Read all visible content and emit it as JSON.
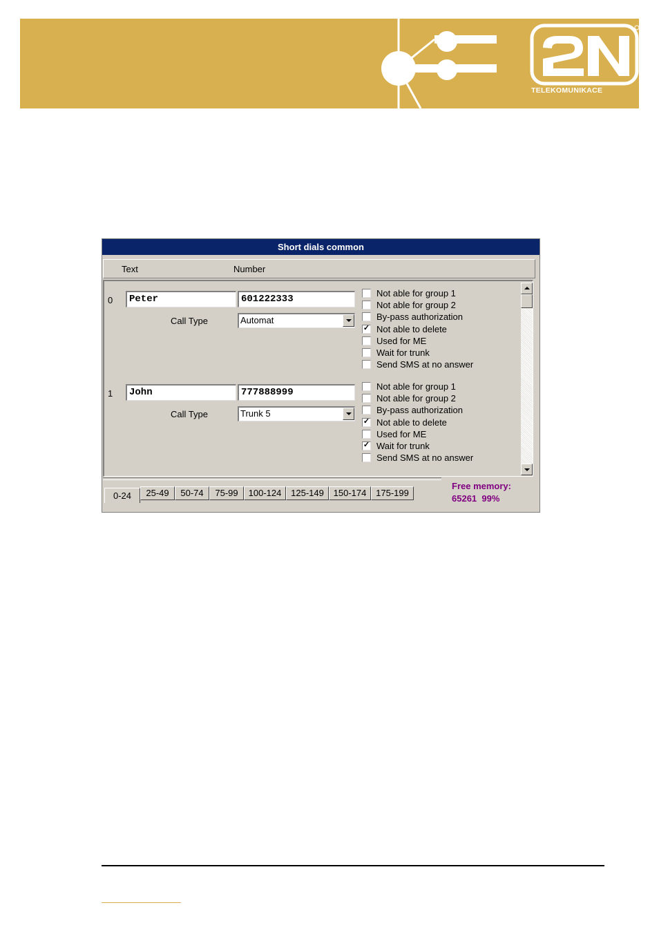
{
  "header": {
    "brand_color": "#d9b04f",
    "logo_text": "2N",
    "logo_tagline": "TELEKOMUNIKACE"
  },
  "window": {
    "title": "Short dials common",
    "columns": {
      "text": "Text",
      "number": "Number"
    },
    "entries": [
      {
        "index": "0",
        "text": "Peter",
        "number": "601222333",
        "call_type_label": "Call Type",
        "call_type": "Automat",
        "options": [
          {
            "label": "Not able for group 1",
            "checked": false
          },
          {
            "label": "Not able for group 2",
            "checked": false
          },
          {
            "label": "By-pass authorization",
            "checked": false
          },
          {
            "label": "Not able to delete",
            "checked": true
          },
          {
            "label": "Used for ME",
            "checked": false
          },
          {
            "label": "Wait for trunk",
            "checked": false
          },
          {
            "label": "Send SMS at no answer",
            "checked": false
          }
        ]
      },
      {
        "index": "1",
        "text": "John",
        "number": "777888999",
        "call_type_label": "Call Type",
        "call_type": "Trunk 5",
        "options": [
          {
            "label": "Not able for group 1",
            "checked": false
          },
          {
            "label": "Not able for group 2",
            "checked": false
          },
          {
            "label": "By-pass authorization",
            "checked": false
          },
          {
            "label": "Not able to delete",
            "checked": true
          },
          {
            "label": "Used for ME",
            "checked": false
          },
          {
            "label": "Wait for trunk",
            "checked": true
          },
          {
            "label": "Send SMS at no answer",
            "checked": false
          }
        ]
      }
    ],
    "tabs": [
      "0-24",
      "25-49",
      "50-74",
      "75-99",
      "100-124",
      "125-149",
      "150-174",
      "175-199"
    ],
    "active_tab": "0-24",
    "free_memory": {
      "label": "Free memory:",
      "value": "65261",
      "percent": "99%"
    }
  }
}
